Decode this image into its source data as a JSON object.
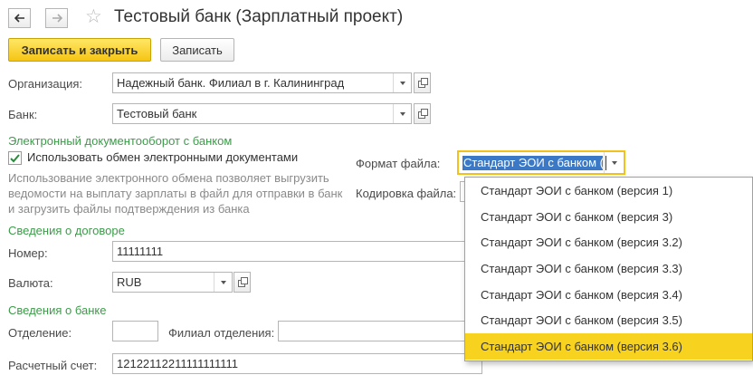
{
  "window": {
    "title": "Тестовый банк (Зарплатный проект)"
  },
  "toolbar": {
    "save_close_label": "Записать и закрыть",
    "save_label": "Записать"
  },
  "form": {
    "organization": {
      "label": "Организация:",
      "value": "Надежный банк. Филиал в г. Калининград"
    },
    "bank": {
      "label": "Банк:",
      "value": "Тестовый банк"
    },
    "edo": {
      "section_title": "Электронный документооборот с банком",
      "checkbox_label": "Использовать обмен электронными документами",
      "checkbox_checked": true,
      "description": "Использование электронного обмена позволяет выгрузить ведомости на выплату зарплаты в файл для отправки в банк и загрузить файлы подтверждения из банка",
      "file_format_label": "Формат файла:",
      "file_format_value": "Стандарт ЭОИ с банком (",
      "encoding_label": "Кодировка файла:"
    },
    "contract": {
      "section_title": "Сведения о договоре",
      "number_label": "Номер:",
      "number_value": "11111111",
      "currency_label": "Валюта:",
      "currency_value": "RUB"
    },
    "bank_info": {
      "section_title": "Сведения о банке",
      "branch_label": "Отделение:",
      "branch_value": "",
      "branch_office_label": "Филиал отделения:",
      "branch_office_value": "",
      "account_label": "Расчетный счет:",
      "account_value": "12122112211111111111"
    }
  },
  "dropdown": {
    "options": [
      "Стандарт ЭОИ с банком (версия 1)",
      "Стандарт ЭОИ с банком (версия 3)",
      "Стандарт ЭОИ с банком (версия 3.2)",
      "Стандарт ЭОИ с банком (версия 3.3)",
      "Стандарт ЭОИ с банком (версия 3.4)",
      "Стандарт ЭОИ с банком (версия 3.5)",
      "Стандарт ЭОИ с банком (версия 3.6)"
    ],
    "selected_index": 6
  },
  "colors": {
    "accent": "#f5c514",
    "section": "#3d9b4a",
    "selection": "#3b78c6",
    "highlight": "#f7d21f"
  }
}
